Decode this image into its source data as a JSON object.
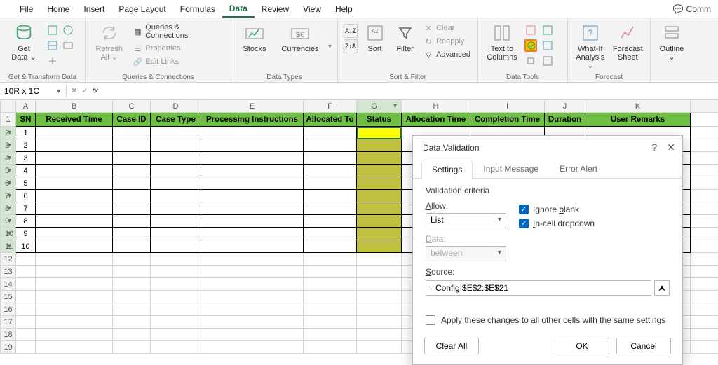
{
  "tabs": [
    "File",
    "Home",
    "Insert",
    "Page Layout",
    "Formulas",
    "Data",
    "Review",
    "View",
    "Help"
  ],
  "active_tab": "Data",
  "comments_btn": "Comm",
  "ribbon": {
    "getdata": {
      "label": "Get\nData ⌄",
      "group": "Get & Transform Data"
    },
    "refresh": {
      "label": "Refresh\nAll ⌄"
    },
    "qc_items": [
      "Queries & Connections",
      "Properties",
      "Edit Links"
    ],
    "qc_group": "Queries & Connections",
    "stocks": "Stocks",
    "currencies": "Currencies",
    "datatypes_group": "Data Types",
    "sort": "Sort",
    "filter": "Filter",
    "filter_items": [
      "Clear",
      "Reapply",
      "Advanced"
    ],
    "sortfilter_group": "Sort & Filter",
    "textcols": "Text to\nColumns",
    "datatools_group": "Data Tools",
    "whatif": "What-If\nAnalysis ⌄",
    "forecastsheet": "Forecast\nSheet",
    "forecast_group": "Forecast",
    "outline": "Outline\n⌄"
  },
  "namebox": "10R x 1C",
  "columns": {
    "A": "SN",
    "B": "Received Time",
    "C": "Case ID",
    "D": "Case Type",
    "E": "Processing Instructions",
    "F": "Allocated To",
    "G": "Status",
    "H": "Allocation Time",
    "I": "Completion Time",
    "J": "Duration",
    "K": "User Remarks"
  },
  "row_numbers": [
    1,
    2,
    3,
    4,
    5,
    6,
    7,
    8,
    9,
    10
  ],
  "dialog": {
    "title": "Data Validation",
    "tabs": [
      "Settings",
      "Input Message",
      "Error Alert"
    ],
    "criteria_label": "Validation criteria",
    "allow_label": "Allow:",
    "allow_value": "List",
    "ignore_blank": "Ignore blank",
    "incell": "In-cell dropdown",
    "data_label": "Data:",
    "data_value": "between",
    "source_label": "Source:",
    "source_value": "=Config!$E$2:$E$21",
    "apply_all": "Apply these changes to all other cells with the same settings",
    "clear": "Clear All",
    "ok": "OK",
    "cancel": "Cancel"
  }
}
